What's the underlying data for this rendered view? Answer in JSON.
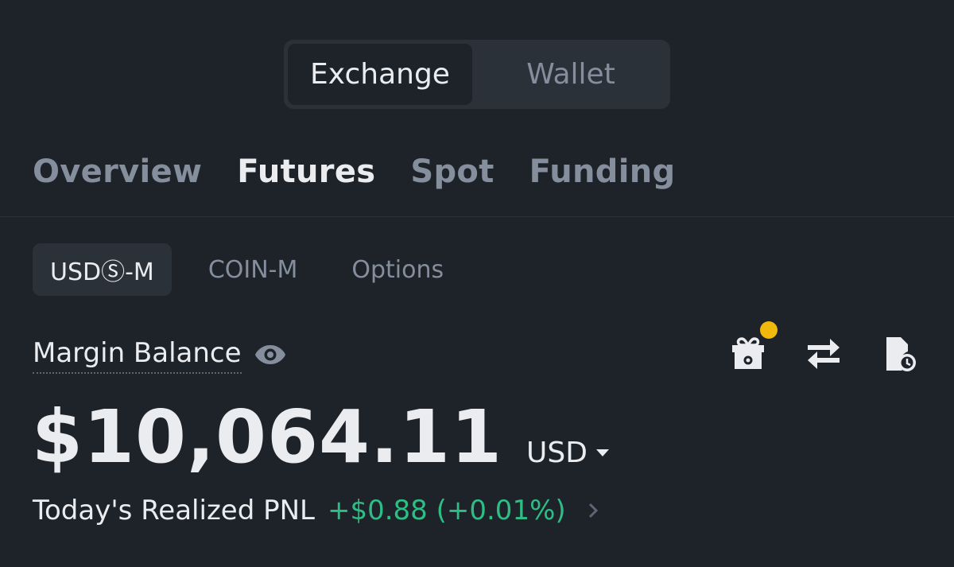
{
  "mode_toggle": {
    "exchange_label": "Exchange",
    "wallet_label": "Wallet",
    "selected": "Exchange"
  },
  "main_tabs": {
    "items": [
      {
        "label": "Overview"
      },
      {
        "label": "Futures"
      },
      {
        "label": "Spot"
      },
      {
        "label": "Funding"
      }
    ],
    "selected": "Futures"
  },
  "sub_tabs": {
    "items": [
      {
        "label": "USDⓈ-M"
      },
      {
        "label": "COIN-M"
      },
      {
        "label": "Options"
      }
    ],
    "selected": "USDⓈ-M"
  },
  "balance": {
    "label": "Margin Balance",
    "value": "$10,064.11",
    "currency": "USD"
  },
  "pnl": {
    "label": "Today's Realized PNL",
    "value": "+$0.88 (+0.01%)"
  },
  "icons": {
    "visibility": "eye-icon",
    "rewards": "gift-icon",
    "transfer": "transfer-icon",
    "history": "history-icon",
    "notification_dot_color": "#f0b90b"
  },
  "colors": {
    "background": "#1e2329",
    "surface": "#2b3139",
    "text_primary": "#eaecef",
    "text_secondary": "#848e9c",
    "positive": "#2ebd85",
    "accent": "#f0b90b"
  }
}
